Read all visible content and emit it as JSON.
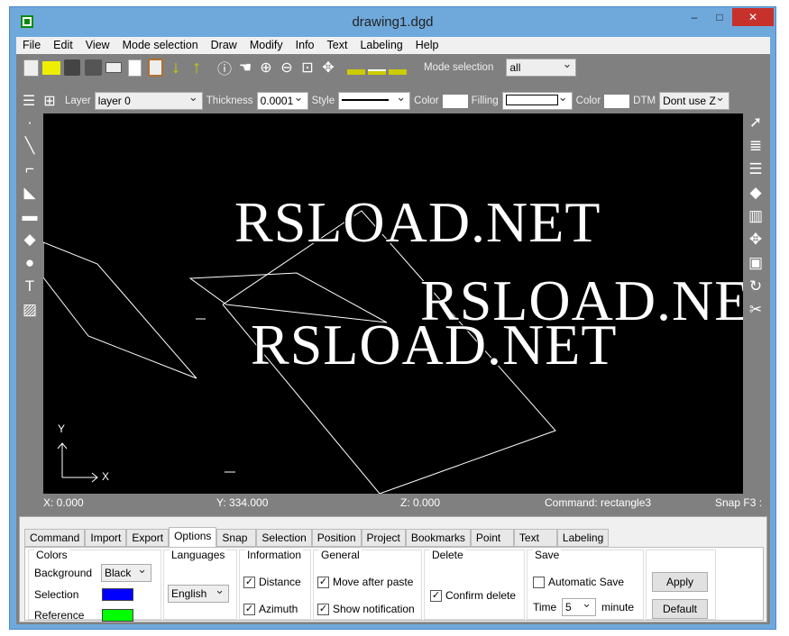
{
  "window": {
    "title": "drawing1.dgd",
    "minimize": "–",
    "maximize": "□",
    "close": "✕"
  },
  "menu": [
    "File",
    "Edit",
    "View",
    "Mode selection",
    "Draw",
    "Modify",
    "Info",
    "Text",
    "Labeling",
    "Help"
  ],
  "toolbar": {
    "mode_selection_label": "Mode selection",
    "mode_selection_value": "all"
  },
  "propbar": {
    "layer_label": "Layer",
    "layer_value": "layer 0",
    "thickness_label": "Thickness",
    "thickness_value": "0.0001",
    "style_label": "Style",
    "color_label": "Color",
    "filling_label": "Filling",
    "color2_label": "Color",
    "dtm_label": "DTM",
    "dtm_value": "Dont use Z"
  },
  "canvas": {
    "texts": [
      "RSLOAD.NET",
      "RSLOAD.NET",
      "RSLOAD.NET"
    ],
    "axis_y": "Y",
    "axis_x": "X"
  },
  "status": {
    "x": "X: 0.000",
    "y": "Y: 334.000",
    "z": "Z: 0.000",
    "command": "Command: rectangle3",
    "snap": "Snap F3 :"
  },
  "tabs": [
    "Command",
    "Import",
    "Export",
    "Options",
    "Snap",
    "Selection",
    "Position",
    "Project",
    "Bookmarks",
    "Point",
    "Text",
    "Labeling"
  ],
  "options": {
    "colors": {
      "title": "Colors",
      "background_label": "Background",
      "background_value": "Black",
      "selection_label": "Selection",
      "selection_color": "#0000ff",
      "reference_label": "Reference",
      "reference_color": "#00ff00"
    },
    "languages": {
      "title": "Languages",
      "value": "English"
    },
    "information": {
      "title": "Information",
      "distance": "Distance",
      "distance_checked": true,
      "azimuth": "Azimuth",
      "azimuth_checked": true
    },
    "general": {
      "title": "General",
      "move_after_paste": "Move after paste",
      "show_notification": "Show notification"
    },
    "delete": {
      "title": "Delete",
      "confirm_delete": "Confirm delete"
    },
    "save": {
      "title": "Save",
      "automatic_save": "Automatic Save",
      "automatic_save_checked": false,
      "time_label": "Time",
      "time_value": "5",
      "minute_label": "minute"
    },
    "apply": "Apply",
    "default": "Default"
  }
}
